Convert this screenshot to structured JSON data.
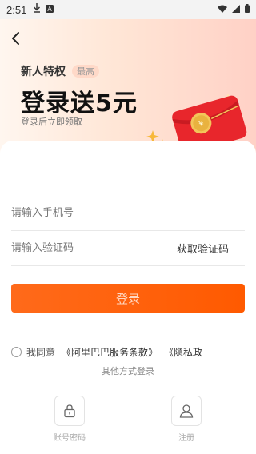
{
  "status_bar": {
    "time": "2:51"
  },
  "hero": {
    "title": "新人特权",
    "badge": "最高",
    "headline": "登录送5元",
    "subtitle": "登录后立即领取"
  },
  "form": {
    "phone_placeholder": "请输入手机号",
    "code_placeholder": "请输入验证码",
    "get_code_label": "获取验证码",
    "login_label": "登录"
  },
  "agreement": {
    "text": "我同意",
    "service_terms": "《阿里巴巴服务条款》",
    "privacy": "《隐私政"
  },
  "other_login": {
    "title": "其他方式登录",
    "methods": [
      {
        "label": "账号密码",
        "icon": "lock-icon"
      },
      {
        "label": "注册",
        "icon": "user-icon"
      }
    ]
  }
}
